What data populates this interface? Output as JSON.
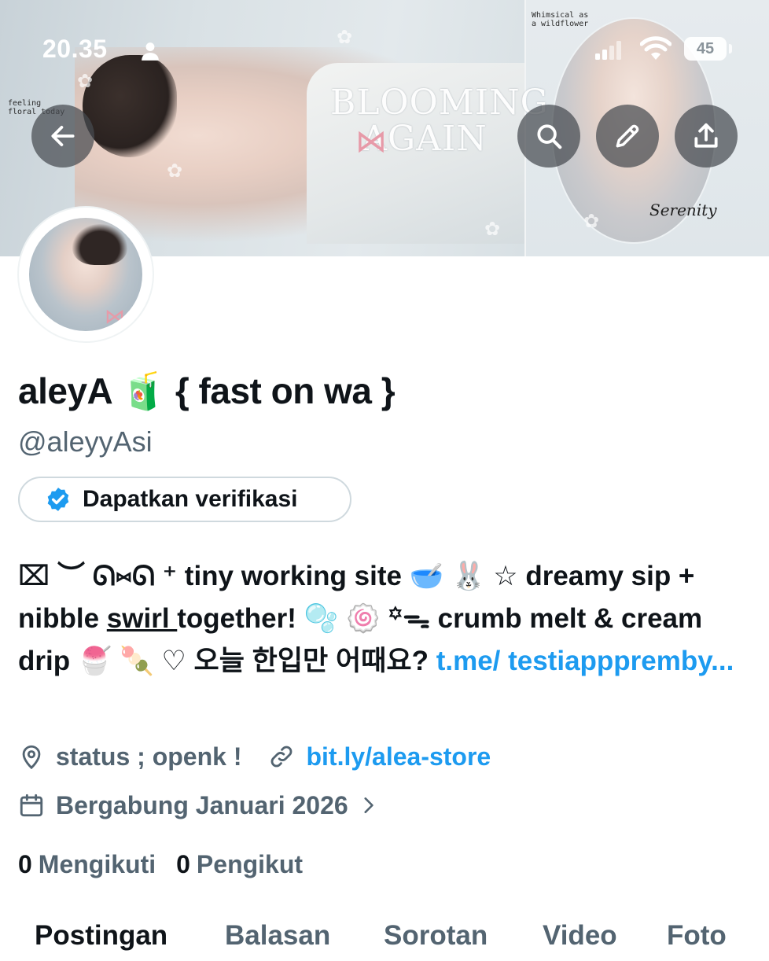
{
  "status_bar": {
    "time": "20.35",
    "battery": "45"
  },
  "banner": {
    "title": "BLOOMING AGAIN",
    "note_left": "feeling\nfloral today",
    "note_right": "Whimsical as\na wildflower",
    "script_text": "Serenity"
  },
  "profile": {
    "display_name": "aleyA 🧃 { fast on wa }",
    "handle": "@aleyyAsi",
    "verify_label": "Dapatkan verifikasi",
    "bio": {
      "part1": "⌧ ︶ ᘏ⑅ᘏ ⁺ tiny working site 🥣 🐰 ☆ dreamy sip + nibble ",
      "underlined": "swirl ",
      "part2": "together! 🫧 🍥 ꙳ᯓ crumb melt & cream drip 🍧 🍡 ♡ 오늘 한입만 어때요? ",
      "link": "t.me/ testiapppremby..."
    },
    "location": "status ; openk !",
    "website": "bit.ly/alea-store",
    "joined": "Bergabung Januari 2026",
    "following_count": "0",
    "following_label": "Mengikuti",
    "followers_count": "0",
    "followers_label": "Pengikut"
  },
  "tabs": [
    {
      "label": "Postingan",
      "active": true
    },
    {
      "label": "Balasan"
    },
    {
      "label": "Sorotan"
    },
    {
      "label": "Video"
    },
    {
      "label": "Foto"
    }
  ],
  "colors": {
    "accent": "#1d9bf0",
    "secondary_text": "#536471",
    "primary_text": "#0f1419"
  }
}
